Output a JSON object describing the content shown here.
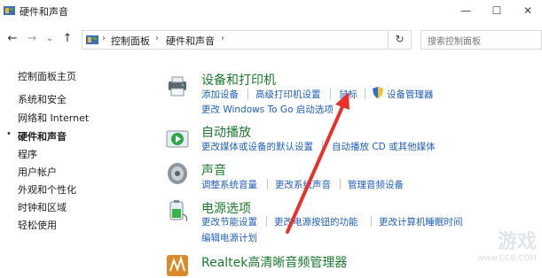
{
  "window": {
    "title": "硬件和声音",
    "controls": {
      "minimize": "—",
      "maximize": "☐",
      "close": "✕"
    }
  },
  "nav": {
    "back": "←",
    "forward": "→",
    "dropdown": "⌄",
    "up": "↑",
    "breadcrumbs": [
      "控制面板",
      "硬件和声音"
    ],
    "separator": "›",
    "refresh": "↻",
    "search_placeholder": "搜索控制面板"
  },
  "sidebar": {
    "items": [
      {
        "label": "控制面板主页"
      },
      {
        "label": "系统和安全"
      },
      {
        "label": "网络和 Internet"
      },
      {
        "label": "硬件和声音",
        "active": true,
        "bullet": "•"
      },
      {
        "label": "程序"
      },
      {
        "label": "用户帐户"
      },
      {
        "label": "外观和个性化"
      },
      {
        "label": "时钟和区域"
      },
      {
        "label": "轻松使用"
      }
    ]
  },
  "categories": [
    {
      "title": "设备和打印机",
      "links": [
        "添加设备",
        "高级打印机设置",
        "鼠标",
        "设备管理器",
        "更改 Windows To Go 启动选项"
      ]
    },
    {
      "title": "自动播放",
      "links": [
        "更改媒体或设备的默认设置",
        "自动播放 CD 或其他媒体"
      ]
    },
    {
      "title": "声音",
      "links": [
        "调整系统音量",
        "更改系统声音",
        "管理音频设备"
      ]
    },
    {
      "title": "电源选项",
      "links": [
        "更改节能设置",
        "更改电源按钮的功能",
        "更改计算机睡眠时间",
        "编辑电源计划"
      ]
    },
    {
      "title": "Realtek高清晰音频管理器",
      "links": []
    }
  ],
  "watermark": {
    "text": "游戏",
    "url": "www.CC8.COM"
  },
  "colors": {
    "category_title": "#1a7a2e",
    "link": "#1f5fbf",
    "arrow": "#e8312a"
  }
}
